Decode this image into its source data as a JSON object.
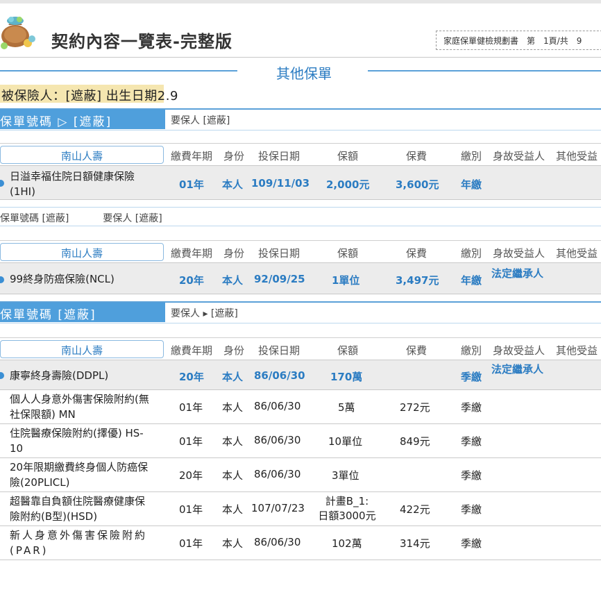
{
  "header": {
    "title": "契約內容一覽表-完整版",
    "box_label": "家庭保單健檢規劃書",
    "page_prefix": "第",
    "page_info": "1頁/共",
    "page_total": "9"
  },
  "section": {
    "title": "其他保單"
  },
  "insured": {
    "text": "被保險人：[遮蔽] 出生日期2.9"
  },
  "columns": [
    "繳費年期",
    "身份",
    "投保日期",
    "保額",
    "保費",
    "繳別",
    "身故受益人",
    "其他受益"
  ],
  "policies": [
    {
      "policy_tag": "保單號碼 ▷ [遮蔽]",
      "holder": "要保人 [遮蔽]",
      "company": "南山人壽",
      "rows": [
        {
          "name_line1": "日溢幸福住院日額健康保險",
          "name_line2": "(1HI)",
          "term": "01年",
          "identity": "本人",
          "date": "109/11/03",
          "amount": "2,000元",
          "premium": "3,600元",
          "freq": "年繳",
          "beneficiary": ""
        }
      ]
    },
    {
      "policy_tag": "保單號碼 [遮蔽]",
      "holder": "要保人 [遮蔽]",
      "company": "南山人壽",
      "rows": [
        {
          "name_line1": "99終身防癌保險(NCL)",
          "name_line2": "",
          "term": "20年",
          "identity": "本人",
          "date": "92/09/25",
          "amount": "1單位",
          "premium": "3,497元",
          "freq": "年繳",
          "beneficiary": "法定繼承人"
        }
      ]
    },
    {
      "policy_tag": "保單號碼 [遮蔽]",
      "holder": "要保人 ▸ [遮蔽]",
      "company": "南山人壽",
      "rows": [
        {
          "name_line1": "康寧終身壽險(DDPL)",
          "name_line2": "",
          "term": "20年",
          "identity": "本人",
          "date": "86/06/30",
          "amount": "170萬",
          "premium": "",
          "freq": "季繳",
          "beneficiary": "法定繼承人"
        },
        {
          "name_line1": "個人人身意外傷害保險附約(無",
          "name_line2": "社保限額) MN",
          "term": "01年",
          "identity": "本人",
          "date": "86/06/30",
          "amount": "5萬",
          "premium": "272元",
          "freq": "季繳",
          "beneficiary": ""
        },
        {
          "name_line1": "住院醫療保險附約(擇優) HS-",
          "name_line2": "10",
          "term": "01年",
          "identity": "本人",
          "date": "86/06/30",
          "amount": "10單位",
          "premium": "849元",
          "freq": "季繳",
          "beneficiary": ""
        },
        {
          "name_line1": "20年限期繳費終身個人防癌保",
          "name_line2": "險(20PLICL)",
          "term": "20年",
          "identity": "本人",
          "date": "86/06/30",
          "amount": "3單位",
          "premium": "",
          "freq": "季繳",
          "beneficiary": ""
        },
        {
          "name_line1": "超醫靠自負額住院醫療健康保",
          "name_line2": "險附約(B型)(HSD)",
          "term": "01年",
          "identity": "本人",
          "date": "107/07/23",
          "amount_line1": "計畫B_1:",
          "amount_line2": "日額3000元",
          "premium": "422元",
          "freq": "季繳",
          "beneficiary": ""
        },
        {
          "name_line1": "新人身意外傷害保險附約",
          "name_line2": "(PAR)",
          "term": "01年",
          "identity": "本人",
          "date": "86/06/30",
          "amount": "102萬",
          "premium": "314元",
          "freq": "季繳",
          "beneficiary": ""
        }
      ]
    }
  ]
}
